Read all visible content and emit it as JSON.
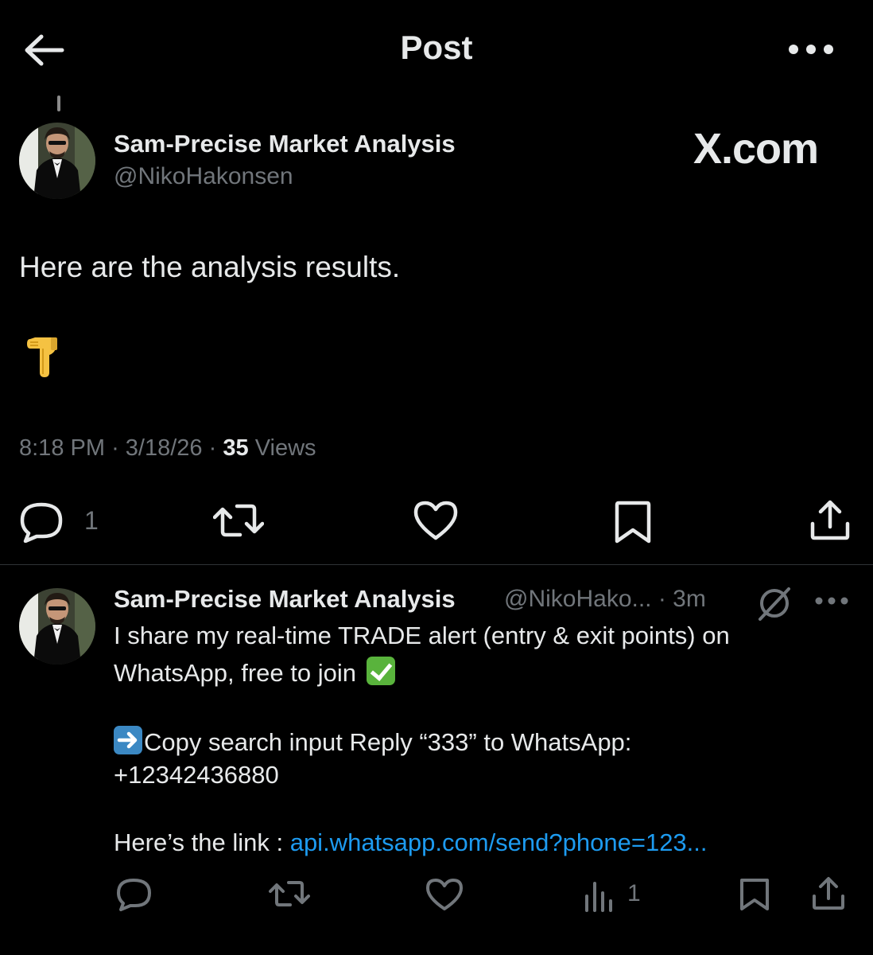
{
  "header": {
    "title": "Post",
    "back_icon": "arrow-left-icon",
    "more_icon": "more-horizontal-icon"
  },
  "main_post": {
    "author_name": "Sam-Precise Market Analysis",
    "handle": "@NikoHakonsen",
    "watermark": "X.com",
    "text": "Here are the analysis results.",
    "emoji": "backhand-index-pointing-down",
    "time": "8:18 PM",
    "date": "3/18/26",
    "views_count": "35",
    "views_label": "Views",
    "separator": "·",
    "actions": {
      "reply_count": "1"
    }
  },
  "reply": {
    "author_name": "Sam-Precise Market Analysis",
    "handle_time": "@NikoHako... · 3m",
    "line1": "I share my real-time TRADE alert (entry & exit points) on",
    "line2": "WhatsApp, free to join",
    "line3": "Copy search input  Reply  “333” to WhatsApp:",
    "line4": "+12342436880",
    "link_prefix": "Here’s the link : ",
    "link_text": "api.whatsapp.com/send?phone=123...",
    "views_count": "1"
  },
  "colors": {
    "background": "#000000",
    "text": "#e7e9ea",
    "muted": "#71767b",
    "link": "#1d9bf0",
    "divider": "#2f3336"
  }
}
